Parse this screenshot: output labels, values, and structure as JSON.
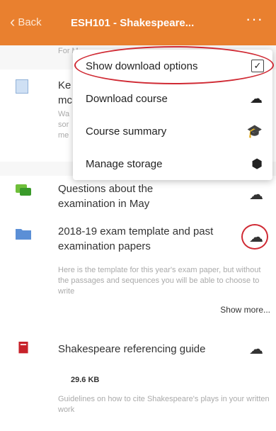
{
  "header": {
    "back_label": "Back",
    "title": "ESH101 - Shakespeare...",
    "more_label": "···"
  },
  "faded_top": "For M...",
  "hidden_item": {
    "title_frag": "Ke\nmc",
    "desc_frag": "Wa\nsor\nme"
  },
  "menu": {
    "items": [
      {
        "label": "Show download options",
        "icon": "checkbox-icon",
        "checked": "✓"
      },
      {
        "label": "Download course",
        "icon": "cloud-download-icon"
      },
      {
        "label": "Course summary",
        "icon": "graduation-cap-icon"
      },
      {
        "label": "Manage storage",
        "icon": "cube-icon"
      }
    ]
  },
  "list": [
    {
      "title": "Questions about the examination in May",
      "icon": "chat-icon"
    },
    {
      "title": "2018-19 exam template and past examination papers",
      "desc": "Here is the template for this year's  exam paper, but without the passages and sequences you will be able to choose to write",
      "icon": "folder-icon",
      "show_more": "Show more..."
    },
    {
      "title": "Shakespeare referencing guide",
      "icon": "pdf-icon",
      "size": "29.6 KB",
      "desc": "Guidelines on how to cite Shakespeare's plays in your written work"
    }
  ],
  "colors": {
    "header": "#e9802f",
    "highlight": "#d02a34"
  }
}
